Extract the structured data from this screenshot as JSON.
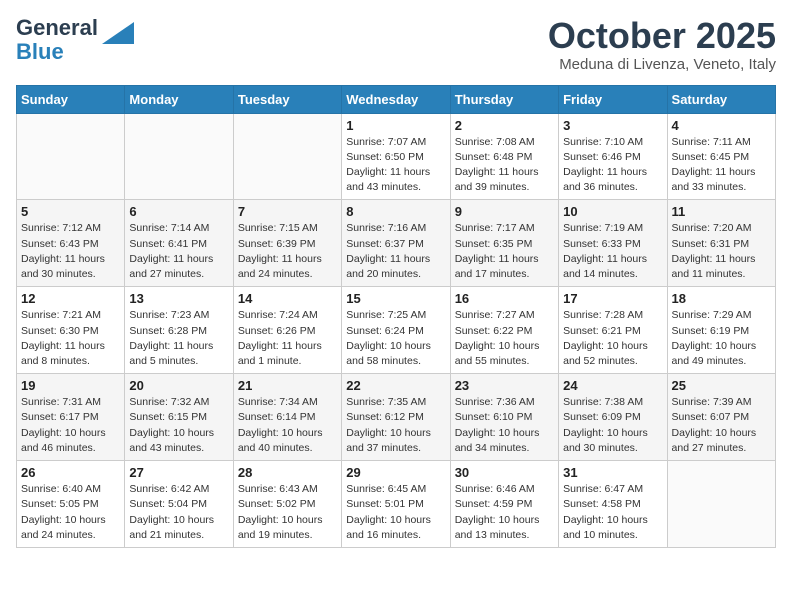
{
  "header": {
    "logo_general": "General",
    "logo_blue": "Blue",
    "month_title": "October 2025",
    "subtitle": "Meduna di Livenza, Veneto, Italy"
  },
  "days_of_week": [
    "Sunday",
    "Monday",
    "Tuesday",
    "Wednesday",
    "Thursday",
    "Friday",
    "Saturday"
  ],
  "weeks": [
    {
      "days": [
        {
          "number": "",
          "info": ""
        },
        {
          "number": "",
          "info": ""
        },
        {
          "number": "",
          "info": ""
        },
        {
          "number": "1",
          "info": "Sunrise: 7:07 AM\nSunset: 6:50 PM\nDaylight: 11 hours\nand 43 minutes."
        },
        {
          "number": "2",
          "info": "Sunrise: 7:08 AM\nSunset: 6:48 PM\nDaylight: 11 hours\nand 39 minutes."
        },
        {
          "number": "3",
          "info": "Sunrise: 7:10 AM\nSunset: 6:46 PM\nDaylight: 11 hours\nand 36 minutes."
        },
        {
          "number": "4",
          "info": "Sunrise: 7:11 AM\nSunset: 6:45 PM\nDaylight: 11 hours\nand 33 minutes."
        }
      ]
    },
    {
      "days": [
        {
          "number": "5",
          "info": "Sunrise: 7:12 AM\nSunset: 6:43 PM\nDaylight: 11 hours\nand 30 minutes."
        },
        {
          "number": "6",
          "info": "Sunrise: 7:14 AM\nSunset: 6:41 PM\nDaylight: 11 hours\nand 27 minutes."
        },
        {
          "number": "7",
          "info": "Sunrise: 7:15 AM\nSunset: 6:39 PM\nDaylight: 11 hours\nand 24 minutes."
        },
        {
          "number": "8",
          "info": "Sunrise: 7:16 AM\nSunset: 6:37 PM\nDaylight: 11 hours\nand 20 minutes."
        },
        {
          "number": "9",
          "info": "Sunrise: 7:17 AM\nSunset: 6:35 PM\nDaylight: 11 hours\nand 17 minutes."
        },
        {
          "number": "10",
          "info": "Sunrise: 7:19 AM\nSunset: 6:33 PM\nDaylight: 11 hours\nand 14 minutes."
        },
        {
          "number": "11",
          "info": "Sunrise: 7:20 AM\nSunset: 6:31 PM\nDaylight: 11 hours\nand 11 minutes."
        }
      ]
    },
    {
      "days": [
        {
          "number": "12",
          "info": "Sunrise: 7:21 AM\nSunset: 6:30 PM\nDaylight: 11 hours\nand 8 minutes."
        },
        {
          "number": "13",
          "info": "Sunrise: 7:23 AM\nSunset: 6:28 PM\nDaylight: 11 hours\nand 5 minutes."
        },
        {
          "number": "14",
          "info": "Sunrise: 7:24 AM\nSunset: 6:26 PM\nDaylight: 11 hours\nand 1 minute."
        },
        {
          "number": "15",
          "info": "Sunrise: 7:25 AM\nSunset: 6:24 PM\nDaylight: 10 hours\nand 58 minutes."
        },
        {
          "number": "16",
          "info": "Sunrise: 7:27 AM\nSunset: 6:22 PM\nDaylight: 10 hours\nand 55 minutes."
        },
        {
          "number": "17",
          "info": "Sunrise: 7:28 AM\nSunset: 6:21 PM\nDaylight: 10 hours\nand 52 minutes."
        },
        {
          "number": "18",
          "info": "Sunrise: 7:29 AM\nSunset: 6:19 PM\nDaylight: 10 hours\nand 49 minutes."
        }
      ]
    },
    {
      "days": [
        {
          "number": "19",
          "info": "Sunrise: 7:31 AM\nSunset: 6:17 PM\nDaylight: 10 hours\nand 46 minutes."
        },
        {
          "number": "20",
          "info": "Sunrise: 7:32 AM\nSunset: 6:15 PM\nDaylight: 10 hours\nand 43 minutes."
        },
        {
          "number": "21",
          "info": "Sunrise: 7:34 AM\nSunset: 6:14 PM\nDaylight: 10 hours\nand 40 minutes."
        },
        {
          "number": "22",
          "info": "Sunrise: 7:35 AM\nSunset: 6:12 PM\nDaylight: 10 hours\nand 37 minutes."
        },
        {
          "number": "23",
          "info": "Sunrise: 7:36 AM\nSunset: 6:10 PM\nDaylight: 10 hours\nand 34 minutes."
        },
        {
          "number": "24",
          "info": "Sunrise: 7:38 AM\nSunset: 6:09 PM\nDaylight: 10 hours\nand 30 minutes."
        },
        {
          "number": "25",
          "info": "Sunrise: 7:39 AM\nSunset: 6:07 PM\nDaylight: 10 hours\nand 27 minutes."
        }
      ]
    },
    {
      "days": [
        {
          "number": "26",
          "info": "Sunrise: 6:40 AM\nSunset: 5:05 PM\nDaylight: 10 hours\nand 24 minutes."
        },
        {
          "number": "27",
          "info": "Sunrise: 6:42 AM\nSunset: 5:04 PM\nDaylight: 10 hours\nand 21 minutes."
        },
        {
          "number": "28",
          "info": "Sunrise: 6:43 AM\nSunset: 5:02 PM\nDaylight: 10 hours\nand 19 minutes."
        },
        {
          "number": "29",
          "info": "Sunrise: 6:45 AM\nSunset: 5:01 PM\nDaylight: 10 hours\nand 16 minutes."
        },
        {
          "number": "30",
          "info": "Sunrise: 6:46 AM\nSunset: 4:59 PM\nDaylight: 10 hours\nand 13 minutes."
        },
        {
          "number": "31",
          "info": "Sunrise: 6:47 AM\nSunset: 4:58 PM\nDaylight: 10 hours\nand 10 minutes."
        },
        {
          "number": "",
          "info": ""
        }
      ]
    }
  ]
}
